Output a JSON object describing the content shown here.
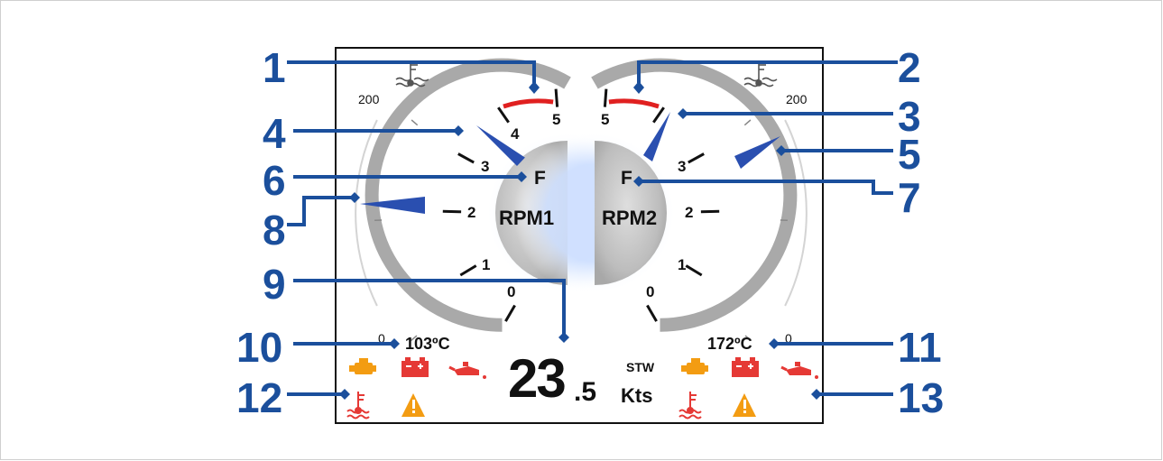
{
  "gauge_left": {
    "ticks": [
      "0",
      "1",
      "2",
      "3",
      "4",
      "5"
    ],
    "rpm_label": "RPM1",
    "fuel_label": "F",
    "temp_scale_label": "200",
    "temp_low_label": "0",
    "temp_value": "103ºC"
  },
  "gauge_right": {
    "ticks": [
      "0",
      "1",
      "2",
      "3",
      "",
      "5"
    ],
    "rpm_label": "RPM2",
    "fuel_label": "F",
    "temp_scale_label": "200",
    "temp_low_label": "0",
    "temp_value": "172ºC"
  },
  "speed": {
    "value_main": "23",
    "value_decimal": ".5",
    "mode": "STW",
    "unit": "Kts"
  },
  "callouts": [
    "1",
    "2",
    "3",
    "4",
    "5",
    "6",
    "7",
    "8",
    "9",
    "10",
    "11",
    "12",
    "13"
  ],
  "colors": {
    "callout_blue": "#1b4f9c",
    "redline": "#e02020",
    "arc_gray": "#a9a9a9",
    "needle_blue": "#2a4fb0",
    "alarm_red": "#e53935",
    "alarm_orange": "#f39c12"
  },
  "icons": [
    "coolant-temp-icon",
    "engine-icon",
    "battery-icon",
    "oil-pressure-icon",
    "warning-icon"
  ]
}
